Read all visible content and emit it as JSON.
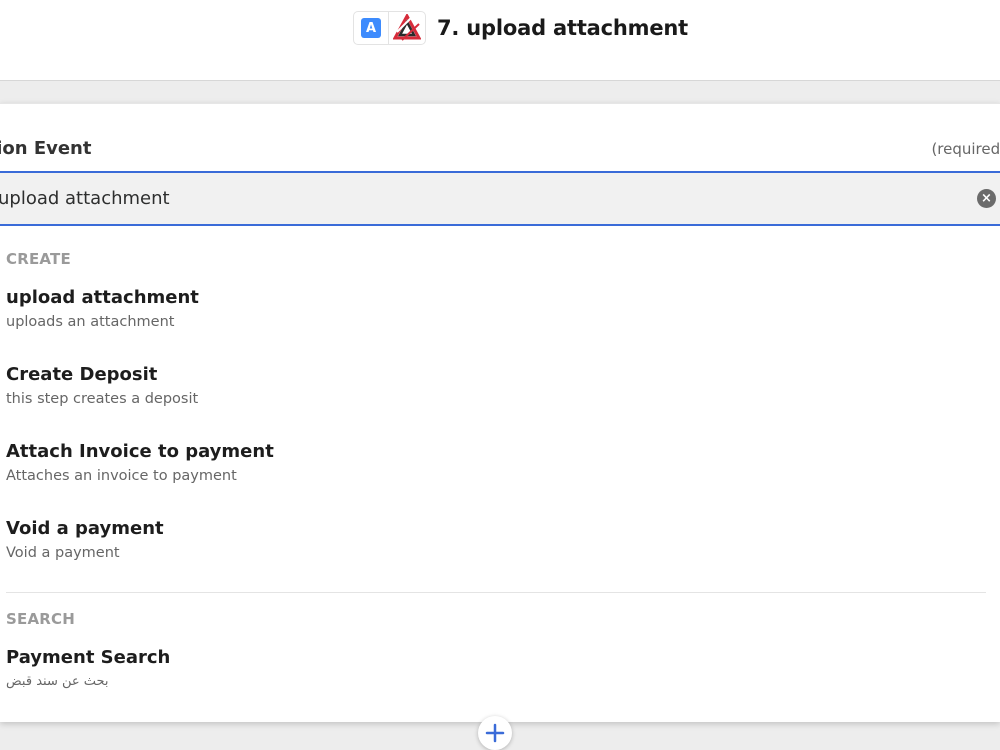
{
  "header": {
    "app_badge_letter": "A",
    "step_title": "7. upload attachment"
  },
  "field": {
    "label": "Action Event",
    "required_text": "(required)"
  },
  "search": {
    "value": "upload attachment",
    "clear_icon": "clear-icon"
  },
  "sections": {
    "create_label": "CREATE",
    "search_label": "SEARCH"
  },
  "options": [
    {
      "title": "upload attachment",
      "desc": "uploads an attachment"
    },
    {
      "title": "Create Deposit",
      "desc": "this step creates a deposit"
    },
    {
      "title": "Attach Invoice to payment",
      "desc": "Attaches an invoice to payment"
    },
    {
      "title": "Void a payment",
      "desc": "Void a payment"
    },
    {
      "title": "Payment Search",
      "desc": "بحث عن سند قبض"
    }
  ],
  "add_step": {
    "icon": "plus-icon"
  },
  "colors": {
    "accent": "#3a6bd8",
    "badge": "#3d8bfd"
  }
}
